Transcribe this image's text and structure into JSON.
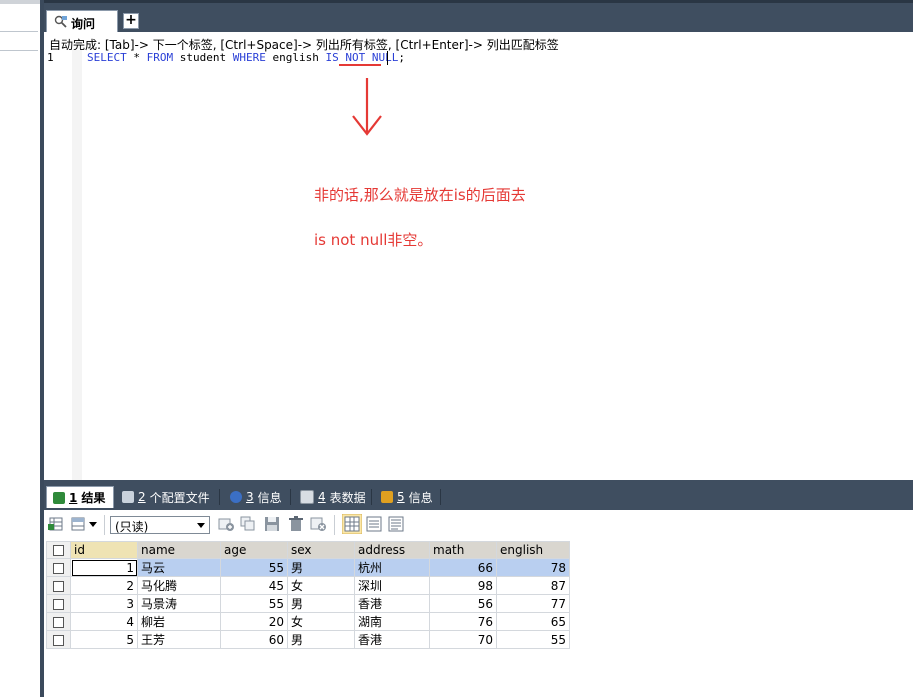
{
  "editor": {
    "tab_label": "询问",
    "new_tab_label": "+",
    "autocomplete_hint": "自动完成: [Tab]-> 下一个标签, [Ctrl+Space]-> 列出所有标签, [Ctrl+Enter]-> 列出匹配标签",
    "line_number": "1",
    "sql": {
      "select": "SELECT",
      "star": " * ",
      "from": "FROM",
      "table": " student ",
      "where": "WHERE",
      "column": " english ",
      "is": "IS",
      "not": "NOT",
      "null": "NULL",
      "semicolon": ";"
    },
    "note_line1": "非的话,那么就是放在is的后面去",
    "note_line2": "is not null非空。"
  },
  "results_tabs": [
    {
      "num": "1",
      "label": "结果"
    },
    {
      "num": "2",
      "label": "个配置文件"
    },
    {
      "num": "3",
      "label": "信息"
    },
    {
      "num": "4",
      "label": "表数据"
    },
    {
      "num": "5",
      "label": "信息"
    }
  ],
  "toolbar": {
    "readonly_value": "(只读)"
  },
  "grid": {
    "columns": [
      "id",
      "name",
      "age",
      "sex",
      "address",
      "math",
      "english"
    ],
    "rows": [
      [
        "1",
        "马云",
        "55",
        "男",
        "杭州",
        "66",
        "78"
      ],
      [
        "2",
        "马化腾",
        "45",
        "女",
        "深圳",
        "98",
        "87"
      ],
      [
        "3",
        "马景涛",
        "55",
        "男",
        "香港",
        "56",
        "77"
      ],
      [
        "4",
        "柳岩",
        "20",
        "女",
        "湖南",
        "76",
        "65"
      ],
      [
        "5",
        "王芳",
        "60",
        "男",
        "香港",
        "70",
        "55"
      ]
    ]
  },
  "colors": {
    "keyword": "#2a3fd6",
    "annotation": "#e53935",
    "selected_row": "#b9cff0",
    "chrome": "#3f4e60"
  }
}
